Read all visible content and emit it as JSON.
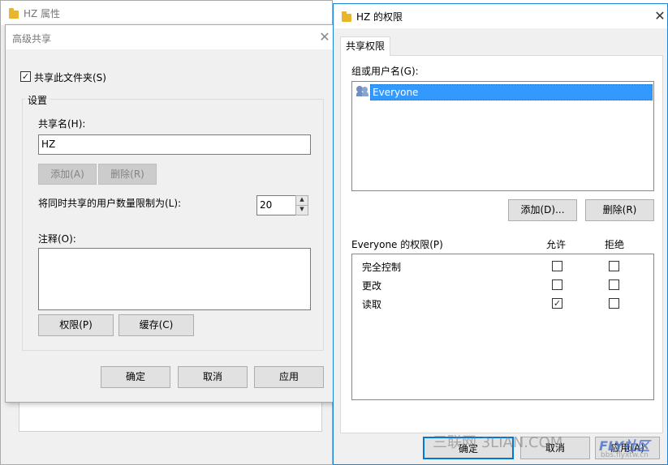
{
  "props_window": {
    "title": "HZ 属性"
  },
  "advanced_sharing": {
    "title": "高级共享",
    "share_folder_label": "共享此文件夹(S)",
    "share_folder_checked": true,
    "settings_group_label": "设置",
    "share_name_label": "共享名(H):",
    "share_name_value": "HZ",
    "add_button": "添加(A)",
    "remove_button": "删除(R)",
    "user_limit_label": "将同时共享的用户数量限制为(L):",
    "user_limit_value": "20",
    "comment_label": "注释(O):",
    "comment_value": "",
    "permissions_button": "权限(P)",
    "caching_button": "缓存(C)",
    "ok_button": "确定",
    "cancel_button": "取消",
    "apply_button": "应用"
  },
  "permissions_window": {
    "title": "HZ 的权限",
    "tab_label": "共享权限",
    "group_users_label": "组或用户名(G):",
    "users": [
      {
        "name": "Everyone",
        "selected": true
      }
    ],
    "add_button": "添加(D)...",
    "remove_button": "删除(R)",
    "permissions_header": "Everyone 的权限(P)",
    "allow_header": "允许",
    "deny_header": "拒绝",
    "permissions": [
      {
        "name": "完全控制",
        "allow": false,
        "deny": false
      },
      {
        "name": "更改",
        "allow": false,
        "deny": false
      },
      {
        "name": "读取",
        "allow": true,
        "deny": false
      }
    ],
    "ok_button": "确定",
    "cancel_button": "取消",
    "apply_button": "应用(A)"
  },
  "watermark": {
    "site_text": "三联网 3LIAN.COM",
    "brand_text": "FLY社区",
    "url_text": "bbs.flyxtw.cn"
  },
  "colors": {
    "selection": "#3399ff",
    "active_border": "#1883d7",
    "dialog_bg": "#f0f0f0",
    "folder": "#e8b62c"
  },
  "icons": {
    "folder": "folder-icon",
    "close": "close-icon",
    "users": "users-group-icon",
    "check": "checkmark-icon"
  }
}
